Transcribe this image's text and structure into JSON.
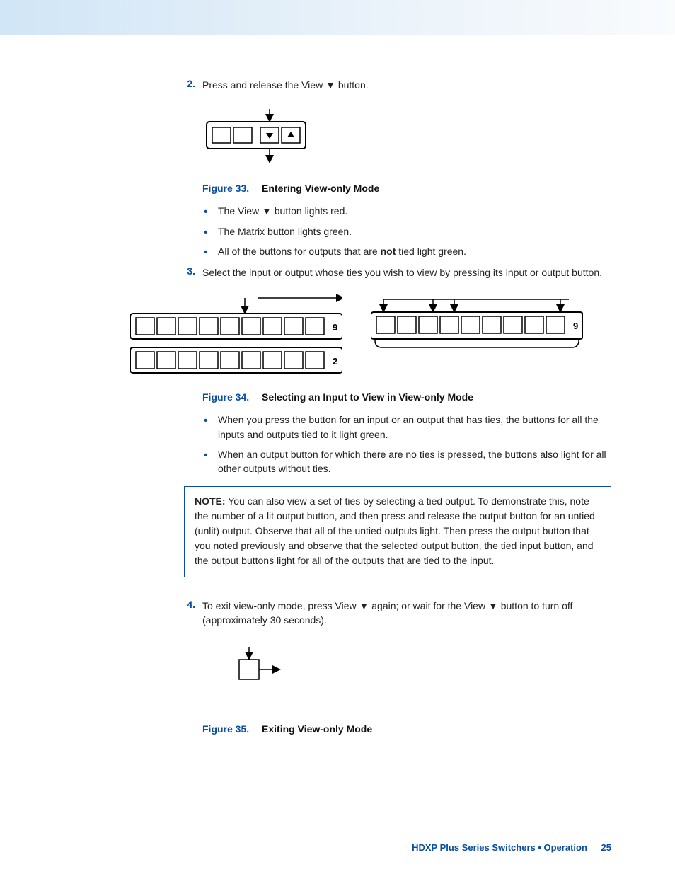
{
  "steps": {
    "s2": {
      "num": "2.",
      "text_pre": "Press and release the View ",
      "glyph": "▼",
      "text_post": " button."
    },
    "s3": {
      "num": "3.",
      "text": "Select the input or output whose ties you wish to view by pressing its input or output button."
    },
    "s4": {
      "num": "4.",
      "text_a": "To exit view-only mode, press View ",
      "glyph1": "▼",
      "text_b": " again; or wait for the View ",
      "glyph2": "▼",
      "text_c": " button to turn off (approximately 30 seconds)."
    }
  },
  "fig33": {
    "label": "Figure 33.",
    "title": "Entering View-only Mode"
  },
  "fig33_bullets": [
    {
      "pre": "The View ",
      "glyph": "▼",
      "post": " button lights red."
    },
    {
      "text": "The Matrix button lights green."
    },
    {
      "pre": "All of the buttons for outputs that are ",
      "bold": "not",
      "post": " tied light green."
    }
  ],
  "fig34": {
    "label": "Figure 34.",
    "title": "Selecting an Input to View in View-only Mode"
  },
  "fig34_bullets": [
    "When you press the button for an input or an output that has ties, the buttons for all the inputs and outputs tied to it light green.",
    "When an output button for which there are no ties is pressed, the buttons also light for all other outputs without ties."
  ],
  "note": {
    "label": "NOTE:",
    "body": "You can also view a set of ties by selecting a tied output. To demonstrate this, note the number of a lit output button, and then press and release the output button for an untied (unlit) output. Observe that all of the untied outputs light. Then press the output button that you noted previously and observe that the selected output button, the tied input button, and the output buttons light for all of the outputs that are tied to the input."
  },
  "fig35": {
    "label": "Figure 35.",
    "title": "Exiting View-only Mode"
  },
  "footer": {
    "text": "HDXP Plus Series Switchers • Operation",
    "page": "25"
  },
  "diagram_labels": {
    "panel_right_end": "9",
    "panel_left_mid": "9",
    "panel_left_bot": "2"
  }
}
